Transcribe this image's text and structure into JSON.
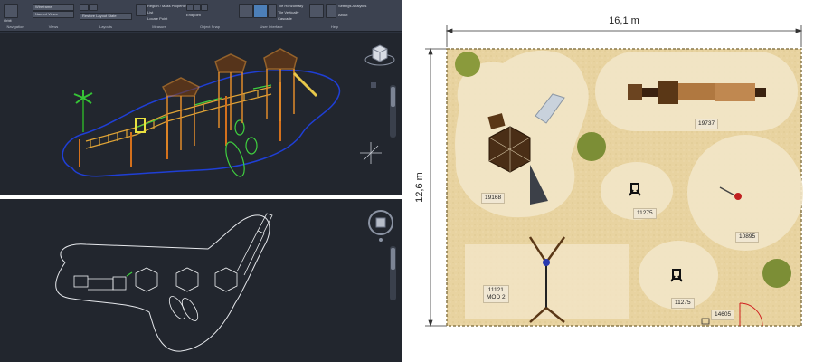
{
  "ribbon": {
    "groups": [
      {
        "label": "Navigation"
      },
      {
        "label": "Views"
      },
      {
        "label": "Layouts"
      },
      {
        "label": "Measure"
      },
      {
        "label": "Object Snap"
      },
      {
        "label": "User Interface"
      },
      {
        "label": "Help"
      }
    ],
    "items": {
      "orbit": "Orbit",
      "wireframe": "Wireframe",
      "named_views": "Named Views",
      "restore_layout": "Restore Layout State",
      "region": "Region / Mass Properties",
      "list": "List",
      "locate_point": "Locate Point",
      "endpoint": "Endpoint",
      "midpoint": "Midpoint",
      "user_interface": "User Interface",
      "tile_horizontally": "Tile Horizontally",
      "tile_vertically": "Tile Vertically",
      "cascade": "Cascade",
      "help": "Help",
      "settings_analytics": "Settings Analytics",
      "about": "About"
    },
    "colors": {
      "ribbon_bg": "#3c4250",
      "viewport_bg": "#22262e",
      "active_button": "#4c7fb8"
    }
  },
  "plan": {
    "width_dim": "16,1 m",
    "height_dim": "12,6 m",
    "labels": [
      "19168",
      "19737",
      "11275",
      "10895",
      "11121",
      "MOD 2",
      "11275",
      "14605"
    ],
    "colors": {
      "sand": "#e8d3a0",
      "zone": "#f2e6c8",
      "border": "#8a7a4c"
    }
  }
}
